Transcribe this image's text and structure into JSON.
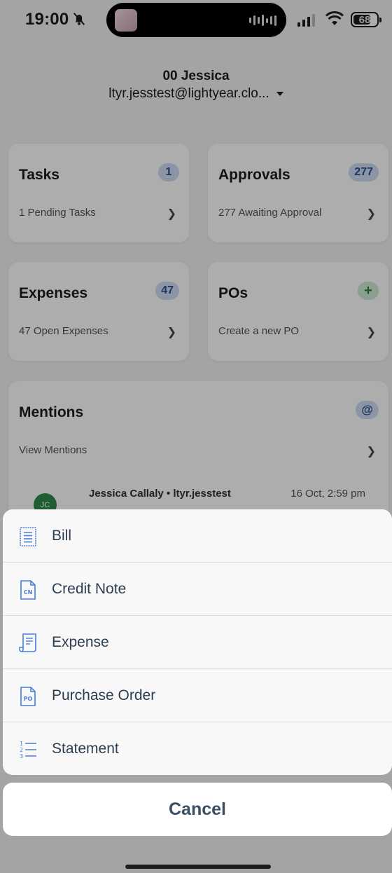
{
  "status_bar": {
    "time": "19:00",
    "battery": "68"
  },
  "account": {
    "name": "00 Jessica",
    "email": "ltyr.jesstest@lightyear.clo..."
  },
  "cards": {
    "tasks": {
      "title": "Tasks",
      "badge": "1",
      "subtitle": "1 Pending Tasks"
    },
    "approvals": {
      "title": "Approvals",
      "badge": "277",
      "subtitle": "277 Awaiting Approval"
    },
    "expenses": {
      "title": "Expenses",
      "badge": "47",
      "subtitle": "47 Open Expenses"
    },
    "pos": {
      "title": "POs",
      "badge": "+",
      "subtitle": "Create a new PO"
    },
    "mentions": {
      "title": "Mentions",
      "badge": "@",
      "subtitle": "View Mentions",
      "latest": {
        "avatar": "JC",
        "author": "Jessica Callaly • ltyr.jesstest",
        "time": "16 Oct, 2:59 pm"
      }
    }
  },
  "action_sheet": {
    "items": [
      {
        "label": "Bill",
        "icon": "bill-icon"
      },
      {
        "label": "Credit Note",
        "icon": "credit-note-icon"
      },
      {
        "label": "Expense",
        "icon": "receipt-icon"
      },
      {
        "label": "Purchase Order",
        "icon": "purchase-order-icon"
      },
      {
        "label": "Statement",
        "icon": "numbered-list-icon"
      }
    ],
    "cancel_label": "Cancel"
  },
  "colors": {
    "icon_blue": "#4a7fd6",
    "badge_blue_bg": "#cfdcf5",
    "badge_green_bg": "#cfe9d3",
    "sheet_text": "#2c3e50"
  }
}
